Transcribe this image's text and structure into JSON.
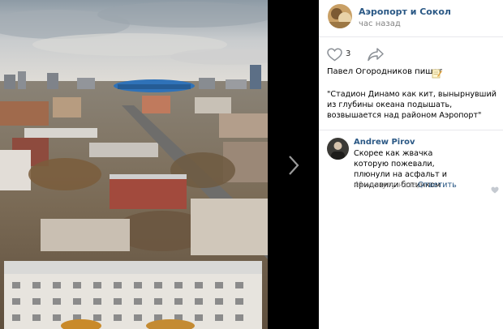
{
  "viewer": {
    "photo_alt": "",
    "next_arrow_icon": "chevron-right-icon"
  },
  "post": {
    "group_name": "Аэропорт и Сокол",
    "time": "час назад",
    "likes": "3",
    "like_icon": "heart-outline-icon",
    "share_icon": "share-arrow-icon",
    "author_line": "Павел Огородников пишет",
    "pencil_icon": "memo-pencil-icon",
    "caption": "\"Стадион Динамо как кит, вынырнувший из глубины океана подышать, возвышается над районом Аэропорт\""
  },
  "comment": {
    "author": "Andrew Pirov",
    "text": "Скорее как жвачка которую пожевали, плюнули на асфальт и придавили ботинком",
    "time": "41 минуту назад",
    "reply_label": "Ответить",
    "like_icon": "small-heart-icon"
  },
  "colors": {
    "link": "#2a5885",
    "muted": "#828282",
    "divider": "#e7e8ec",
    "viewer_bg": "#000000"
  }
}
